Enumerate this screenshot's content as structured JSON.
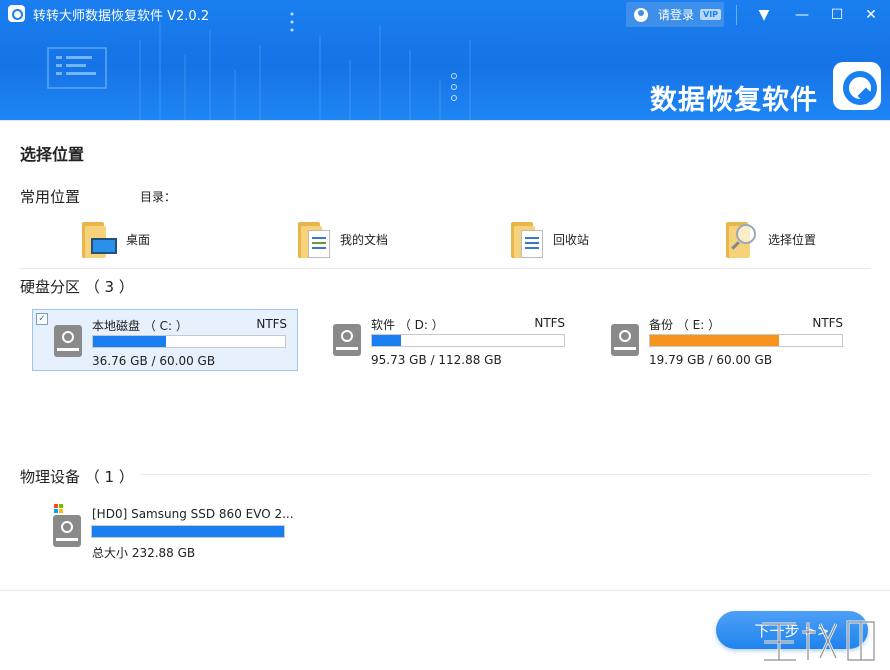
{
  "app": {
    "title": "转转大师数据恢复软件 V2.0.2",
    "brand_text": "数据恢复软件"
  },
  "login": {
    "label": "请登录",
    "vip": "VIP"
  },
  "window_buttons": {
    "menu": "▼",
    "minimize": "—",
    "maximize": "☐",
    "close": "✕"
  },
  "page": {
    "heading": "选择位置"
  },
  "common": {
    "title": "常用位置",
    "dir_label": "目录：",
    "items": [
      {
        "label": "桌面",
        "icon": "desktop-folder-icon"
      },
      {
        "label": "我的文档",
        "icon": "documents-folder-icon"
      },
      {
        "label": "回收站",
        "icon": "recycle-bin-folder-icon"
      },
      {
        "label": "选择位置",
        "icon": "browse-folder-icon"
      }
    ]
  },
  "partitions": {
    "title": "硬盘分区 （ 3 ）",
    "items": [
      {
        "name": "本地磁盘 （ C: ）",
        "fs": "NTFS",
        "size": "36.76 GB / 60.00 GB",
        "used_fraction": 0.38,
        "color": "#1a7ff0",
        "selected": true
      },
      {
        "name": "软件 （ D: ）",
        "fs": "NTFS",
        "size": "95.73 GB / 112.88 GB",
        "used_fraction": 0.15,
        "color": "#1a7ff0",
        "selected": false
      },
      {
        "name": "备份 （ E: ）",
        "fs": "NTFS",
        "size": "19.79 GB / 60.00 GB",
        "used_fraction": 0.67,
        "color": "#f7941d",
        "selected": false
      }
    ]
  },
  "physical": {
    "title": "物理设备 （ 1 ）",
    "items": [
      {
        "name": "[HD0] Samsung SSD 860 EVO 2...",
        "size": "总大小 232.88 GB",
        "used_fraction": 1.0,
        "color": "#1a7ff0"
      }
    ]
  },
  "next_button": {
    "label": "下一步 >>"
  }
}
